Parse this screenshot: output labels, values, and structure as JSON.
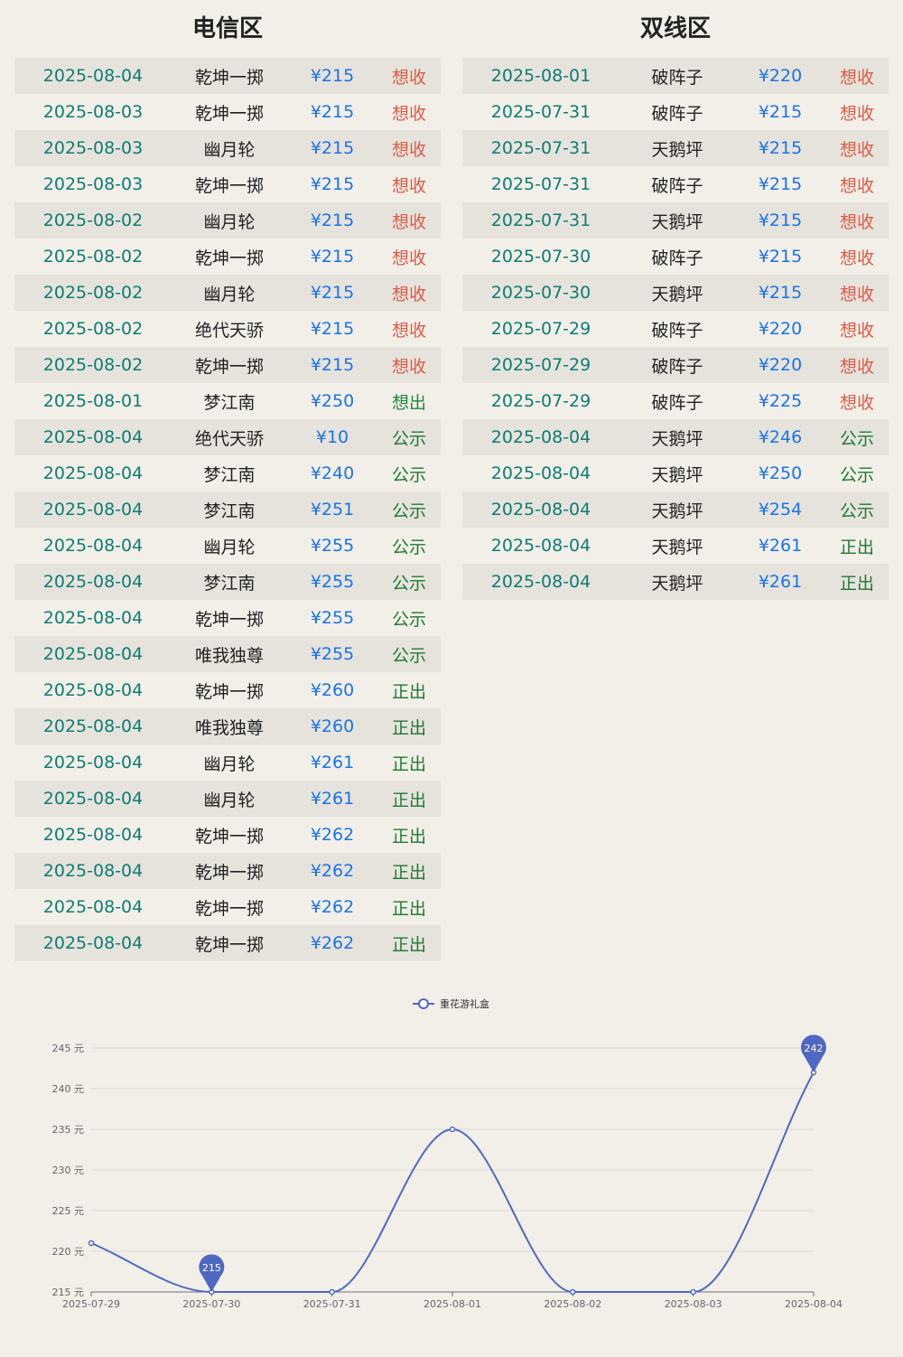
{
  "telecom": {
    "title": "电信区",
    "rows": [
      {
        "date": "2025-08-04",
        "server": "乾坤一掷",
        "price": "¥215",
        "type": "想收",
        "kind": "buy"
      },
      {
        "date": "2025-08-03",
        "server": "乾坤一掷",
        "price": "¥215",
        "type": "想收",
        "kind": "buy"
      },
      {
        "date": "2025-08-03",
        "server": "幽月轮",
        "price": "¥215",
        "type": "想收",
        "kind": "buy"
      },
      {
        "date": "2025-08-03",
        "server": "乾坤一掷",
        "price": "¥215",
        "type": "想收",
        "kind": "buy"
      },
      {
        "date": "2025-08-02",
        "server": "幽月轮",
        "price": "¥215",
        "type": "想收",
        "kind": "buy"
      },
      {
        "date": "2025-08-02",
        "server": "乾坤一掷",
        "price": "¥215",
        "type": "想收",
        "kind": "buy"
      },
      {
        "date": "2025-08-02",
        "server": "幽月轮",
        "price": "¥215",
        "type": "想收",
        "kind": "buy"
      },
      {
        "date": "2025-08-02",
        "server": "绝代天骄",
        "price": "¥215",
        "type": "想收",
        "kind": "buy"
      },
      {
        "date": "2025-08-02",
        "server": "乾坤一掷",
        "price": "¥215",
        "type": "想收",
        "kind": "buy"
      },
      {
        "date": "2025-08-01",
        "server": "梦江南",
        "price": "¥250",
        "type": "想出",
        "kind": "sell"
      },
      {
        "date": "2025-08-04",
        "server": "绝代天骄",
        "price": "¥10",
        "type": "公示",
        "kind": "public"
      },
      {
        "date": "2025-08-04",
        "server": "梦江南",
        "price": "¥240",
        "type": "公示",
        "kind": "public"
      },
      {
        "date": "2025-08-04",
        "server": "梦江南",
        "price": "¥251",
        "type": "公示",
        "kind": "public"
      },
      {
        "date": "2025-08-04",
        "server": "幽月轮",
        "price": "¥255",
        "type": "公示",
        "kind": "public"
      },
      {
        "date": "2025-08-04",
        "server": "梦江南",
        "price": "¥255",
        "type": "公示",
        "kind": "public"
      },
      {
        "date": "2025-08-04",
        "server": "乾坤一掷",
        "price": "¥255",
        "type": "公示",
        "kind": "public"
      },
      {
        "date": "2025-08-04",
        "server": "唯我独尊",
        "price": "¥255",
        "type": "公示",
        "kind": "public"
      },
      {
        "date": "2025-08-04",
        "server": "乾坤一掷",
        "price": "¥260",
        "type": "正出",
        "kind": "sold"
      },
      {
        "date": "2025-08-04",
        "server": "唯我独尊",
        "price": "¥260",
        "type": "正出",
        "kind": "sold"
      },
      {
        "date": "2025-08-04",
        "server": "幽月轮",
        "price": "¥261",
        "type": "正出",
        "kind": "sold"
      },
      {
        "date": "2025-08-04",
        "server": "幽月轮",
        "price": "¥261",
        "type": "正出",
        "kind": "sold"
      },
      {
        "date": "2025-08-04",
        "server": "乾坤一掷",
        "price": "¥262",
        "type": "正出",
        "kind": "sold"
      },
      {
        "date": "2025-08-04",
        "server": "乾坤一掷",
        "price": "¥262",
        "type": "正出",
        "kind": "sold"
      },
      {
        "date": "2025-08-04",
        "server": "乾坤一掷",
        "price": "¥262",
        "type": "正出",
        "kind": "sold"
      },
      {
        "date": "2025-08-04",
        "server": "乾坤一掷",
        "price": "¥262",
        "type": "正出",
        "kind": "sold"
      }
    ]
  },
  "dual": {
    "title": "双线区",
    "rows": [
      {
        "date": "2025-08-01",
        "server": "破阵子",
        "price": "¥220",
        "type": "想收",
        "kind": "buy"
      },
      {
        "date": "2025-07-31",
        "server": "破阵子",
        "price": "¥215",
        "type": "想收",
        "kind": "buy"
      },
      {
        "date": "2025-07-31",
        "server": "天鹅坪",
        "price": "¥215",
        "type": "想收",
        "kind": "buy"
      },
      {
        "date": "2025-07-31",
        "server": "破阵子",
        "price": "¥215",
        "type": "想收",
        "kind": "buy"
      },
      {
        "date": "2025-07-31",
        "server": "天鹅坪",
        "price": "¥215",
        "type": "想收",
        "kind": "buy"
      },
      {
        "date": "2025-07-30",
        "server": "破阵子",
        "price": "¥215",
        "type": "想收",
        "kind": "buy"
      },
      {
        "date": "2025-07-30",
        "server": "天鹅坪",
        "price": "¥215",
        "type": "想收",
        "kind": "buy"
      },
      {
        "date": "2025-07-29",
        "server": "破阵子",
        "price": "¥220",
        "type": "想收",
        "kind": "buy"
      },
      {
        "date": "2025-07-29",
        "server": "破阵子",
        "price": "¥220",
        "type": "想收",
        "kind": "buy"
      },
      {
        "date": "2025-07-29",
        "server": "破阵子",
        "price": "¥225",
        "type": "想收",
        "kind": "buy"
      },
      {
        "date": "2025-08-04",
        "server": "天鹅坪",
        "price": "¥246",
        "type": "公示",
        "kind": "public"
      },
      {
        "date": "2025-08-04",
        "server": "天鹅坪",
        "price": "¥250",
        "type": "公示",
        "kind": "public"
      },
      {
        "date": "2025-08-04",
        "server": "天鹅坪",
        "price": "¥254",
        "type": "公示",
        "kind": "public"
      },
      {
        "date": "2025-08-04",
        "server": "天鹅坪",
        "price": "¥261",
        "type": "正出",
        "kind": "sold"
      },
      {
        "date": "2025-08-04",
        "server": "天鹅坪",
        "price": "¥261",
        "type": "正出",
        "kind": "sold"
      }
    ]
  },
  "colors": {
    "line": "#4f68c1",
    "buy": "#e05a43",
    "sell": "#1e8a3c",
    "date": "#0e7d72",
    "price": "#1a73e8"
  },
  "chart_data": {
    "type": "line",
    "smooth": true,
    "x": [
      "2025-07-29",
      "2025-07-30",
      "2025-07-31",
      "2025-08-01",
      "2025-08-02",
      "2025-08-03",
      "2025-08-04"
    ],
    "series": [
      {
        "name": "重花游礼盒",
        "values": [
          221,
          215,
          215,
          235,
          215,
          215,
          242
        ]
      }
    ],
    "ylim": [
      215,
      245
    ],
    "yticks": [
      215,
      220,
      225,
      230,
      235,
      240,
      245
    ],
    "yunit": "元",
    "markers": [
      {
        "label": "215",
        "x": "2025-07-30",
        "value": 215
      },
      {
        "label": "242",
        "x": "2025-08-04",
        "value": 242
      }
    ],
    "grid": true,
    "legend_position": "top-center"
  }
}
